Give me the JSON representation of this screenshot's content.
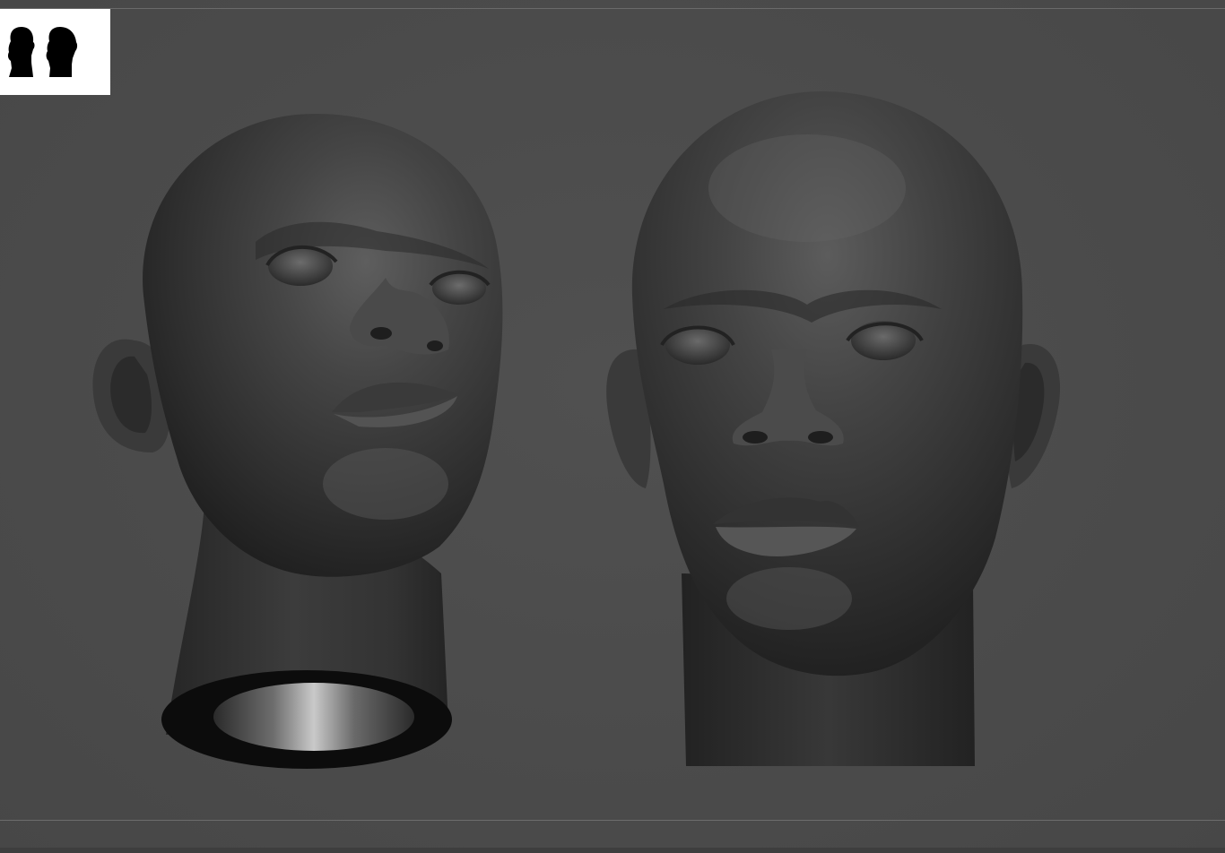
{
  "viewport": {
    "background": "#4b4b4b"
  },
  "thumbnail": {
    "background": "#ffffff",
    "icons": [
      "head-silhouette-icon",
      "head-silhouette-icon"
    ]
  },
  "models": [
    {
      "name": "bald-head-sculpt-three-quarter-view",
      "color": "#3a3a3a"
    },
    {
      "name": "bald-head-sculpt-front-view",
      "color": "#3a3a3a"
    }
  ]
}
